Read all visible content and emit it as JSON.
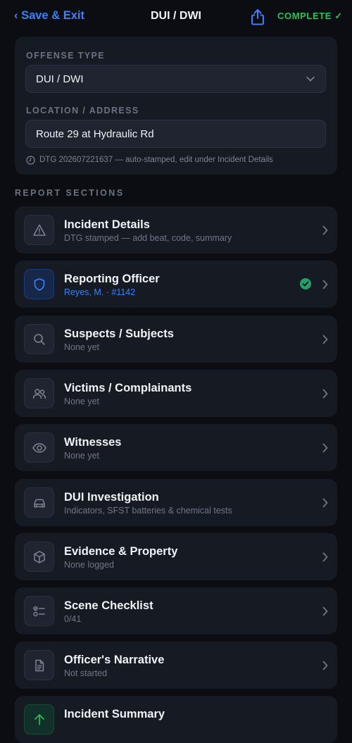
{
  "nav": {
    "back_label": "‹ Save & Exit",
    "title": "DUI / DWI",
    "complete_label": "COMPLETE ✓"
  },
  "offense": {
    "type_label": "OFFENSE TYPE",
    "type_value": "DUI / DWI",
    "location_label": "LOCATION / ADDRESS",
    "location_value": "Route 29 at Hydraulic Rd",
    "dtg_note": "DTG 202607221637 — auto-stamped, edit under Incident Details"
  },
  "sections_label": "REPORT SECTIONS",
  "sections": [
    {
      "title": "Incident Details",
      "subtitle": "DTG stamped — add beat, code, summary",
      "icon": "warning-icon"
    },
    {
      "title": "Reporting Officer",
      "subtitle": "Reyes, M. · #1142",
      "icon": "shield-icon",
      "complete": true
    },
    {
      "title": "Suspects / Subjects",
      "subtitle": "None yet",
      "icon": "search-icon"
    },
    {
      "title": "Victims / Complainants",
      "subtitle": "None yet",
      "icon": "people-icon"
    },
    {
      "title": "Witnesses",
      "subtitle": "None yet",
      "icon": "eye-icon"
    },
    {
      "title": "DUI Investigation",
      "subtitle": "Indicators, SFST batteries & chemical tests",
      "icon": "car-icon"
    },
    {
      "title": "Evidence & Property",
      "subtitle": "None logged",
      "icon": "box-icon"
    },
    {
      "title": "Scene Checklist",
      "subtitle": "0/41",
      "icon": "checklist-icon"
    },
    {
      "title": "Officer's Narrative",
      "subtitle": "Not started",
      "icon": "document-icon"
    },
    {
      "title": "Incident Summary",
      "subtitle": "",
      "icon": "summary-icon"
    }
  ],
  "colors": {
    "accent_blue": "#3b82f6",
    "complete_green": "#22c55e",
    "background": "#0b0d12",
    "card": "#161a22"
  }
}
